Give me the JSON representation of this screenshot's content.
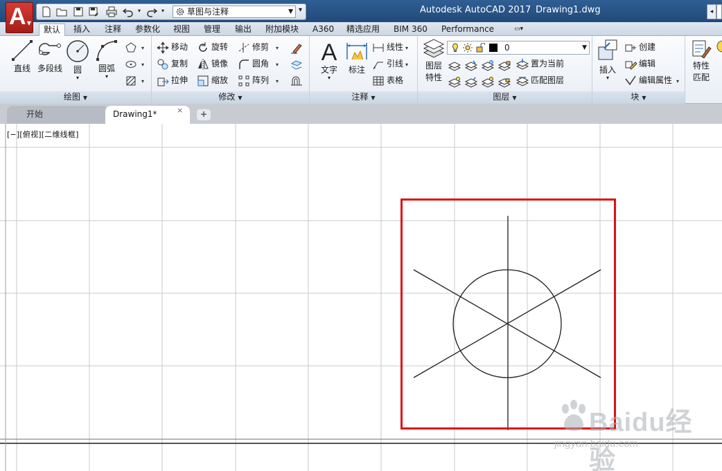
{
  "window": {
    "app_title": "Autodesk AutoCAD 2017",
    "file_title": "Drawing1.dwg",
    "app_button_glyph": "A"
  },
  "quick_access": {
    "workspace": "草图与注释",
    "icons": [
      "new-icon",
      "open-icon",
      "save-icon",
      "save-as-icon",
      "print-icon",
      "undo-icon",
      "redo-icon",
      "gear-icon"
    ]
  },
  "ribbon_tabs": [
    "默认",
    "插入",
    "注释",
    "参数化",
    "视图",
    "管理",
    "输出",
    "附加模块",
    "A360",
    "精选应用",
    "BIM 360",
    "Performance"
  ],
  "active_tab_index": 0,
  "panels": {
    "draw": {
      "title": "绘图",
      "line": "直线",
      "polyline": "多段线",
      "circle": "圆",
      "arc": "圆弧"
    },
    "modify": {
      "title": "修改",
      "move": "移动",
      "rotate": "旋转",
      "trim": "修剪",
      "copy": "复制",
      "mirror": "镜像",
      "fillet": "圆角",
      "stretch": "拉伸",
      "scale": "缩放",
      "array": "阵列"
    },
    "annotation": {
      "title": "注释",
      "text": "文字",
      "dimension": "标注",
      "linear": "线性",
      "leader": "引线",
      "table": "表格"
    },
    "layers": {
      "title": "图层",
      "properties_line1": "图层",
      "properties_line2": "特性",
      "current_layer": "0",
      "make_current": "置为当前",
      "match_layer": "匹配图层"
    },
    "block": {
      "title": "块",
      "insert": "插入",
      "create": "创建",
      "edit": "编辑",
      "edit_attributes": "编辑属性"
    },
    "properties": {
      "line1": "特性",
      "line2": "匹配"
    }
  },
  "doc_tabs": {
    "start": "开始",
    "drawing": "Drawing1*",
    "close": "×",
    "new": "+"
  },
  "viewport": {
    "label": "[−][俯视][二维线框]"
  },
  "colors": {
    "titlebar": "#2a5688",
    "highlight_box": "#e01010",
    "grid": "#c8c8c8",
    "geometry": "#1c1c1c"
  },
  "watermark": {
    "brand": "Baidu经验",
    "url": "jingyan.baidu.com"
  }
}
